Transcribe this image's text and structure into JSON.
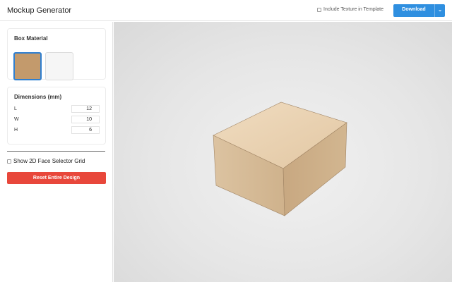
{
  "header": {
    "title": "Mockup Generator",
    "texture_option_label": "Include Texture in Template",
    "download_label": "Download",
    "download_caret": "⌄"
  },
  "sidebar": {
    "material": {
      "title": "Box Material",
      "swatches": [
        {
          "name": "kraft",
          "color": "#c39a6c",
          "selected": true
        },
        {
          "name": "white",
          "color": "#f6f6f6",
          "selected": false
        }
      ]
    },
    "dimensions": {
      "title": "Dimensions (mm)",
      "rows": [
        {
          "label": "L",
          "value": "12"
        },
        {
          "label": "W",
          "value": "10"
        },
        {
          "label": "H",
          "value": "6"
        }
      ]
    },
    "grid_toggle_label": "Show 2D Face Selector Grid",
    "reset_label": "Reset Entire Design"
  },
  "colors": {
    "accent": "#2f8fe0",
    "danger": "#e8473b",
    "box_top": "#ead1b2",
    "box_front": "#d6bb97",
    "box_side": "#c9ab84"
  }
}
